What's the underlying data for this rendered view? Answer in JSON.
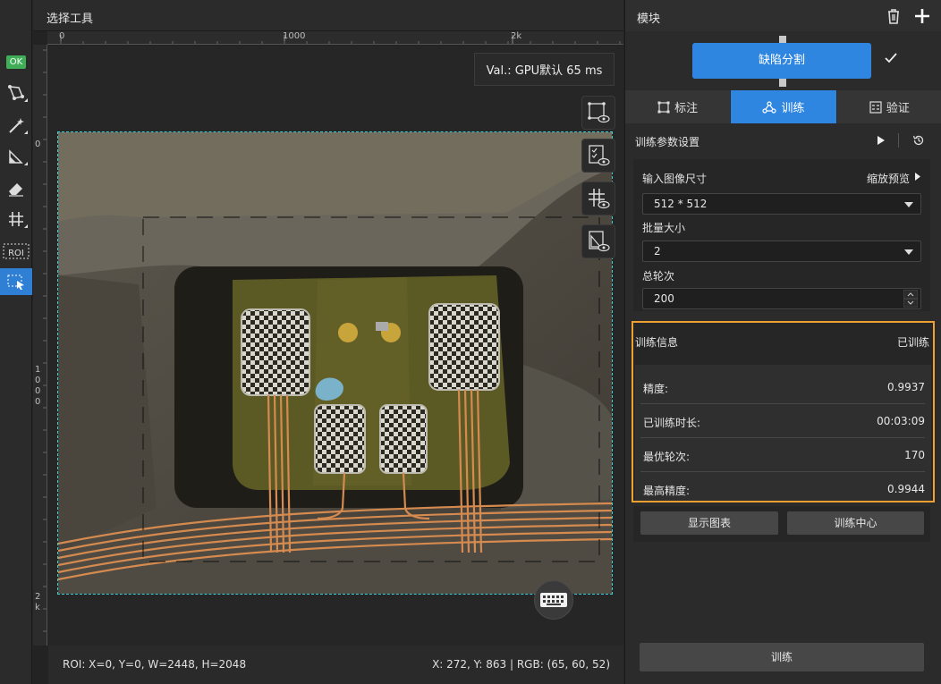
{
  "canvas": {
    "header_title": "选择工具",
    "ruler_top_labels": [
      "0",
      "1000",
      "2k"
    ],
    "ruler_left_labels": [
      "0",
      "1\n0\n0\n0",
      "2\nk"
    ],
    "val_text": "Val.: GPU默认 65 ms",
    "status_left": "ROI: X=0, Y=0, W=2448, H=2048",
    "status_right": "X: 272, Y: 863 | RGB: (65, 60, 52)"
  },
  "toolbar": {
    "ok_label": "OK",
    "roi_label": "ROI",
    "tools": [
      "polygon-tool-icon",
      "magic-wand-icon",
      "fill-tool-icon",
      "eraser-icon",
      "grid-tool-icon",
      "roi-tool-icon",
      "select-tool-icon"
    ]
  },
  "panel": {
    "module_title": "模块",
    "module_button": "缺陷分割",
    "tabs": [
      "标注",
      "训练",
      "验证"
    ],
    "param_title": "训练参数设置",
    "input_size_label": "输入图像尺寸",
    "preview_label": "缩放预览",
    "input_size_value": "512 * 512",
    "batch_label": "批量大小",
    "batch_value": "2",
    "epochs_label": "总轮次",
    "epochs_value": "200",
    "info_title": "训练信息",
    "info_status": "已训练",
    "info_rows": [
      {
        "label": "精度:",
        "value": "0.9937"
      },
      {
        "label": "已训练时长:",
        "value": "00:03:09"
      },
      {
        "label": "最优轮次:",
        "value": "170"
      },
      {
        "label": "最高精度:",
        "value": "0.9944"
      }
    ],
    "chart_button": "显示图表",
    "center_button": "训练中心",
    "train_button": "训练"
  },
  "colors": {
    "accent": "#2f86e0",
    "highlight": "#f0a030",
    "ok": "#3fae56",
    "roi_border": "#3ad1d6"
  }
}
